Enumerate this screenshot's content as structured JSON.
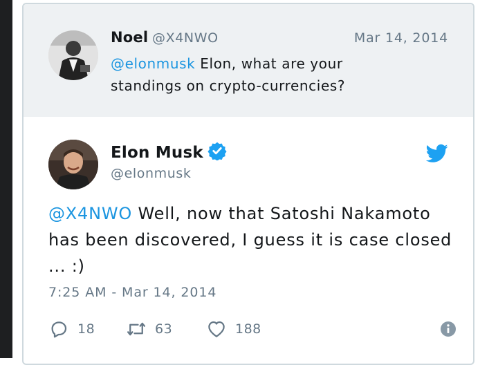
{
  "quoted_tweet": {
    "name": "Noel",
    "handle": "@X4NWO",
    "date": "Mar 14, 2014",
    "mention": "@elonmusk",
    "text": " Elon, what are your standings on crypto-currencies?"
  },
  "tweet": {
    "name": "Elon Musk",
    "handle": "@elonmusk",
    "mention": "@X4NWO",
    "text": " Well, now that Satoshi Nakamoto has been discovered, I guess it is case closed ... :)",
    "timestamp": "7:25 AM - Mar 14, 2014",
    "reply_count": "18",
    "retweet_count": "63",
    "like_count": "188"
  },
  "icons": {
    "verified": "verified-badge-icon",
    "brand": "twitter-bird-icon",
    "reply": "reply-icon",
    "retweet": "retweet-icon",
    "like": "heart-icon",
    "info": "info-icon"
  },
  "colors": {
    "link_blue": "#1b95e0",
    "twitter_blue": "#1da1f2",
    "secondary_text": "#657786",
    "quoted_background": "#eef1f3"
  }
}
